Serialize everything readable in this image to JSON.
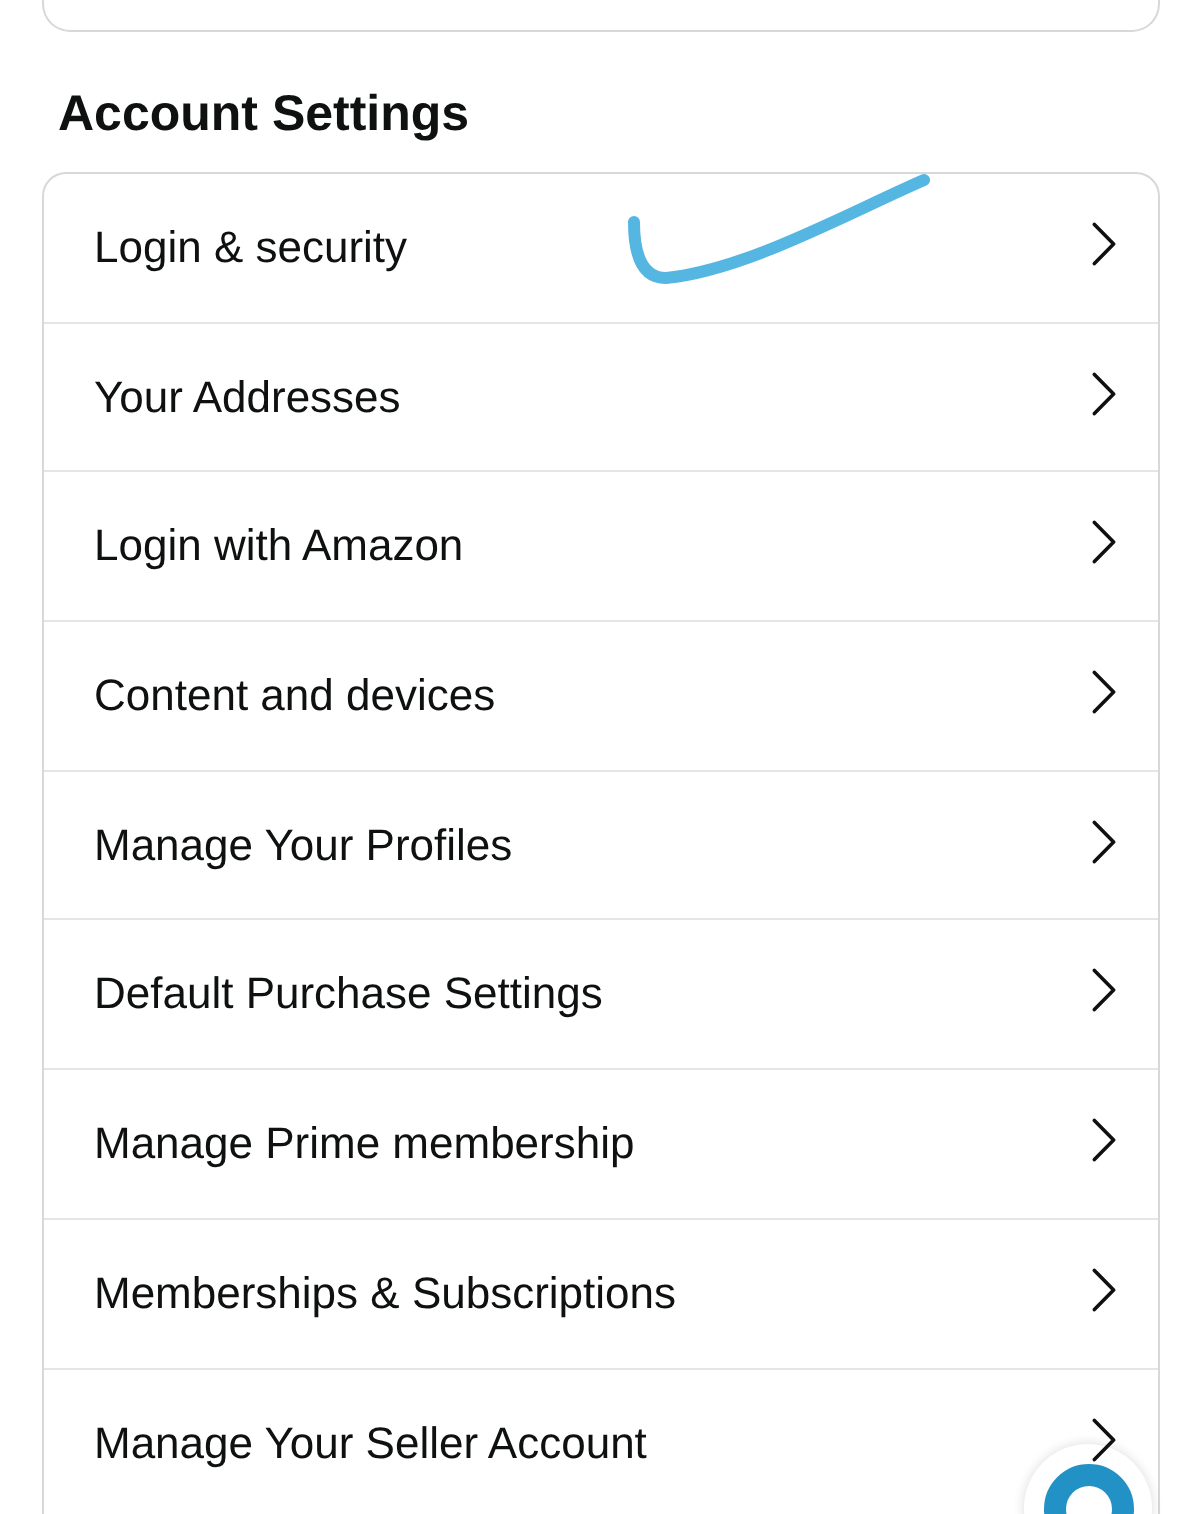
{
  "account_settings": {
    "title": "Account Settings",
    "items": [
      {
        "label": "Login & security",
        "marked": true
      },
      {
        "label": "Your Addresses",
        "marked": false
      },
      {
        "label": "Login with Amazon",
        "marked": false
      },
      {
        "label": "Content and devices",
        "marked": false
      },
      {
        "label": "Manage Your Profiles",
        "marked": false
      },
      {
        "label": "Default Purchase Settings",
        "marked": false
      },
      {
        "label": "Manage Prime membership",
        "marked": false
      },
      {
        "label": "Memberships & Subscriptions",
        "marked": false
      },
      {
        "label": "Manage Your Seller Account",
        "marked": false
      }
    ]
  }
}
